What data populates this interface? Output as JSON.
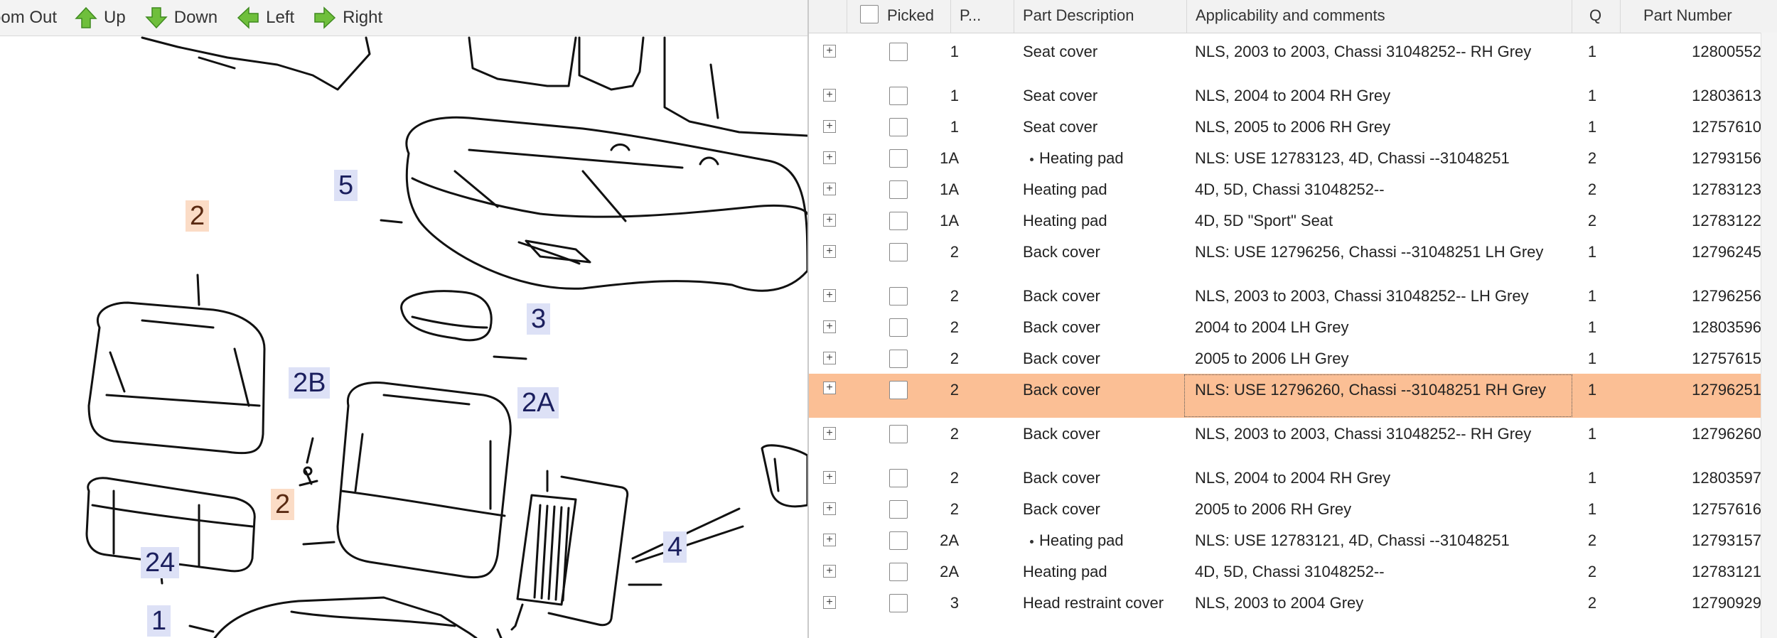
{
  "toolbar": {
    "zoom_out": "oom Out",
    "up": "Up",
    "down": "Down",
    "left": "Left",
    "right": "Right"
  },
  "diagram": {
    "callouts": {
      "c5": "5",
      "c2_top": "2",
      "c3": "3",
      "c2b": "2B",
      "c2a": "2A",
      "c2_mid": "2",
      "c4": "4",
      "c24": "24",
      "c1": "1"
    }
  },
  "table": {
    "headers": {
      "picked": "Picked",
      "pos": "P...",
      "description": "Part Description",
      "applicability": "Applicability and comments",
      "qty": "Q",
      "part_number": "Part Number"
    },
    "rows": [
      {
        "pos": "1",
        "desc": "Seat cover",
        "app": "NLS, 2003 to 2003, Chassi 31048252-- RH Grey",
        "qty": "1",
        "pn": "12800552"
      },
      {
        "pos": "1",
        "desc": "Seat cover",
        "app": "NLS, 2004 to 2004 RH Grey",
        "qty": "1",
        "pn": "12803613"
      },
      {
        "pos": "1",
        "desc": "Seat cover",
        "app": "NLS, 2005 to 2006 RH Grey",
        "qty": "1",
        "pn": "12757610"
      },
      {
        "pos": "1A",
        "desc": "Heating pad",
        "app": "NLS: USE 12783123, 4D, Chassi --31048251",
        "qty": "2",
        "pn": "12793156"
      },
      {
        "pos": "1A",
        "desc": "Heating pad",
        "app": "4D, 5D, Chassi 31048252--",
        "qty": "2",
        "pn": "12783123"
      },
      {
        "pos": "1A",
        "desc": "Heating pad",
        "app": "4D, 5D \"Sport\" Seat",
        "qty": "2",
        "pn": "12783122"
      },
      {
        "pos": "2",
        "desc": "Back cover",
        "app": "NLS: USE 12796256, Chassi --31048251 LH Grey",
        "qty": "1",
        "pn": "12796245"
      },
      {
        "pos": "2",
        "desc": "Back cover",
        "app": "NLS, 2003 to 2003, Chassi 31048252-- LH Grey",
        "qty": "1",
        "pn": "12796256"
      },
      {
        "pos": "2",
        "desc": "Back cover",
        "app": "2004 to 2004 LH Grey",
        "qty": "1",
        "pn": "12803596"
      },
      {
        "pos": "2",
        "desc": "Back cover",
        "app": "2005 to 2006 LH Grey",
        "qty": "1",
        "pn": "12757615"
      },
      {
        "pos": "2",
        "desc": "Back cover",
        "app": "NLS: USE 12796260, Chassi --31048251 RH Grey",
        "qty": "1",
        "pn": "12796251"
      },
      {
        "pos": "2",
        "desc": "Back cover",
        "app": "NLS, 2003 to 2003, Chassi 31048252-- RH Grey",
        "qty": "1",
        "pn": "12796260"
      },
      {
        "pos": "2",
        "desc": "Back cover",
        "app": "NLS, 2004 to 2004 RH Grey",
        "qty": "1",
        "pn": "12803597"
      },
      {
        "pos": "2",
        "desc": "Back cover",
        "app": "2005 to 2006 RH Grey",
        "qty": "1",
        "pn": "12757616"
      },
      {
        "pos": "2A",
        "desc": "Heating pad",
        "app": "NLS: USE 12783121, 4D, Chassi --31048251",
        "qty": "2",
        "pn": "12793157"
      },
      {
        "pos": "2A",
        "desc": "Heating pad",
        "app": "4D, 5D, Chassi 31048252--",
        "qty": "2",
        "pn": "12783121"
      },
      {
        "pos": "3",
        "desc": "Head restraint cover",
        "app": "NLS, 2003 to 2004 Grey",
        "qty": "2",
        "pn": "12790929"
      }
    ],
    "bulleted_rows": [
      3,
      14
    ],
    "selected_row": 10
  },
  "colors": {
    "selected_row": "#fbbf95",
    "callout_blue": "#dde1f6",
    "callout_orange": "#fbdcc6",
    "arrow_green": "#6fbf3c"
  },
  "icons": {
    "up": "arrow-up-icon",
    "down": "arrow-down-icon",
    "left": "arrow-left-icon",
    "right": "arrow-right-icon",
    "expand": "expand-plus-icon"
  }
}
